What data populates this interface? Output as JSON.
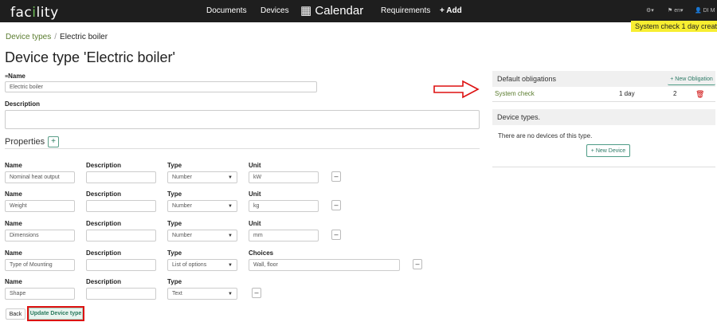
{
  "navbar": {
    "logo": "facility",
    "items": [
      "Documents",
      "Devices",
      "Requirements"
    ],
    "calendar": "Calendar",
    "add": "+ Add",
    "settings": "⚙▾",
    "language": "⚑ en▾",
    "user": "👤 DI M"
  },
  "breadcrumb": {
    "parent": "Device types",
    "current": "Electric boiler"
  },
  "toast": "System check 1 day creat",
  "page": {
    "title": "Device type 'Electric boiler'"
  },
  "form": {
    "name_label": "Name",
    "name_value": "Electric boiler",
    "description_label": "Description",
    "description_value": ""
  },
  "properties": {
    "title": "Properties",
    "add": "+",
    "col_labels": {
      "name": "Name",
      "description": "Description",
      "type": "Type",
      "unit": "Unit",
      "choices": "Choices"
    },
    "rows": [
      {
        "name": "Nominal heat output",
        "description": "",
        "type": "Number",
        "extra": "kW"
      },
      {
        "name": "Weight",
        "description": "",
        "type": "Number",
        "extra": "kg"
      },
      {
        "name": "Dimensions",
        "description": "",
        "type": "Number",
        "extra": "mm"
      },
      {
        "name": "Type of Mounting",
        "description": "",
        "type": "List of options",
        "extra": "Wall, floor"
      },
      {
        "name": "Shape",
        "description": "",
        "type": "Text",
        "extra": ""
      }
    ],
    "remove": "–"
  },
  "obligations": {
    "title": "Default obligations",
    "new_button": "+ New Obligation",
    "rows": [
      {
        "name": "System check",
        "period": "1 day",
        "count": "2"
      }
    ]
  },
  "device_types": {
    "title": "Device types.",
    "empty_text": "There are no devices of this type.",
    "new_button": "+ New Device"
  },
  "actions": {
    "back": "Back",
    "update": "Update Device type"
  },
  "colors": {
    "navbar": "#1e1e1e",
    "accent_green": "#5a7c2e",
    "teal": "#2d7a66",
    "toast": "#f7ee31",
    "arrow": "#d11"
  }
}
